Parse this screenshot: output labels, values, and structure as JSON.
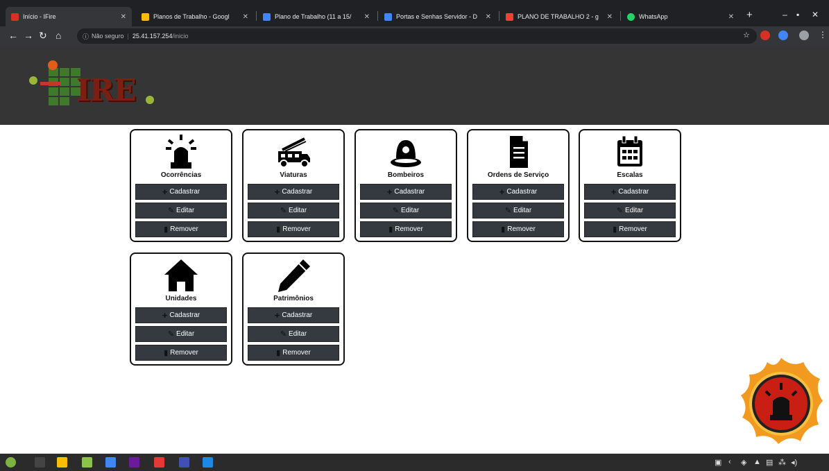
{
  "browser": {
    "tabs": [
      {
        "title": "Início - IFire",
        "favicon_color": "#d93025",
        "active": true
      },
      {
        "title": "Planos de Trabalho - Googl",
        "favicon_color": "#fbbc04",
        "active": false
      },
      {
        "title": "Plano de Trabalho (11 a 15/",
        "favicon_color": "#4285f4",
        "active": false
      },
      {
        "title": "Portas e Senhas Servidor - D",
        "favicon_color": "#4285f4",
        "active": false
      },
      {
        "title": "PLANO DE TRABALHO 2 - g",
        "favicon_color": "#ea4335",
        "active": false
      },
      {
        "title": "WhatsApp",
        "favicon_color": "#25d366",
        "active": false
      }
    ],
    "new_tab_icon": "plus-icon",
    "address": {
      "security_label": "Não seguro",
      "host": "25.41.157.254",
      "path": "/inicio"
    }
  },
  "header": {
    "logo_text": "IRE"
  },
  "cards": [
    {
      "title": "Ocorrências",
      "icon": "siren-icon"
    },
    {
      "title": "Viaturas",
      "icon": "fire-truck-icon"
    },
    {
      "title": "Bombeiros",
      "icon": "firefighter-helmet-icon"
    },
    {
      "title": "Ordens de Serviço",
      "icon": "document-icon"
    },
    {
      "title": "Escalas",
      "icon": "calendar-icon"
    },
    {
      "title": "Unidades",
      "icon": "house-icon"
    },
    {
      "title": "Patrimônios",
      "icon": "pencil-icon"
    }
  ],
  "actions": {
    "create": "Cadastrar",
    "edit": "Editar",
    "remove": "Remover"
  },
  "colors": {
    "header_bg": "#353535",
    "button_bg": "#343a40",
    "browser_bg": "#202124"
  }
}
